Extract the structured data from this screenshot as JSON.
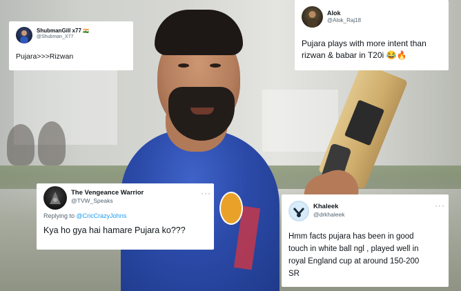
{
  "tweets": [
    {
      "display_name": "ShubmanGill x77",
      "flag": "🇮🇳",
      "handle": "@Shubman_X77",
      "text": "Pujara>>>Rizwan"
    },
    {
      "display_name": "Alok",
      "handle": "@Alok_Raj18",
      "text_line1": "Pujara plays with more intent than",
      "text_line2": "rizwan & babar in T20i 😂🔥"
    },
    {
      "display_name": "The Vengeance Warrior",
      "handle": "@TVW_Speaks",
      "more": "···",
      "reply_prefix": "Replying to",
      "reply_to": "@CricCrazyJohns",
      "text": "Kya ho gya hai hamare Pujara ko???"
    },
    {
      "display_name": "Khaleek",
      "handle": "@drkhaleek",
      "more": "···",
      "text_line1": "Hmm facts pujara has been in good",
      "text_line2": "touch in white ball ngl , played well in",
      "text_line3": "royal England cup at around 150-200",
      "text_line4": "SR"
    }
  ],
  "colors": {
    "card_bg": "#ffffff",
    "text": "#0f1419",
    "muted": "#536471",
    "link": "#1d9bf0",
    "shirt": "#2b4aa8"
  }
}
